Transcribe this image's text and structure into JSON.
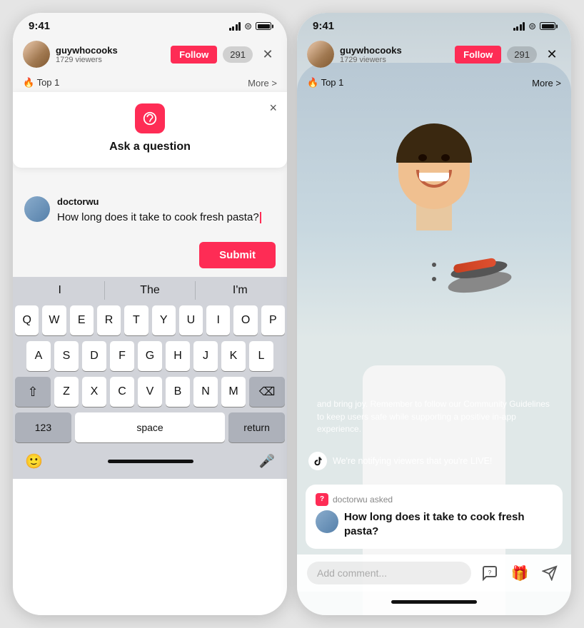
{
  "phones": {
    "left": {
      "status": {
        "time": "9:41",
        "battery": 100
      },
      "topBar": {
        "username": "guywhocooks",
        "viewers": "1729 viewers",
        "followLabel": "Follow",
        "viewerCount": "291"
      },
      "labelBar": {
        "topBadge": "🔥 Top 1",
        "moreLabel": "More >"
      },
      "modal": {
        "title": "Ask a question",
        "closeLabel": "×"
      },
      "question": {
        "askerName": "doctorwu",
        "questionText": "How long does it take to cook fresh pasta?"
      },
      "submitLabel": "Submit",
      "keyboard": {
        "suggestions": [
          "I",
          "The",
          "I'm"
        ],
        "rows": [
          [
            "Q",
            "W",
            "E",
            "R",
            "T",
            "Y",
            "U",
            "I",
            "O",
            "P"
          ],
          [
            "A",
            "S",
            "D",
            "F",
            "G",
            "H",
            "J",
            "K",
            "L"
          ],
          [
            "⇧",
            "Z",
            "X",
            "C",
            "V",
            "B",
            "N",
            "M",
            "⌫"
          ],
          [
            "123",
            "space",
            "return"
          ]
        ]
      }
    },
    "right": {
      "status": {
        "time": "9:41"
      },
      "topBar": {
        "username": "guywhocooks",
        "viewers": "1729 viewers",
        "followLabel": "Follow",
        "viewerCount": "291"
      },
      "labelBar": {
        "topBadge": "🔥 Top 1",
        "moreLabel": "More >"
      },
      "communityText": "and bring joy. Remember to follow our Community Guidelines to keep users safe while supporting a positive in-app experience.",
      "liveNotice": "We're notifying viewers that you're LIVE!",
      "questionCard": {
        "askedBy": "doctorwu asked",
        "questionText": "How long does it take to cook fresh pasta?"
      },
      "commentPlaceholder": "Add comment...",
      "actions": {
        "question": "?",
        "gift": "🎁",
        "share": "↗"
      }
    }
  }
}
